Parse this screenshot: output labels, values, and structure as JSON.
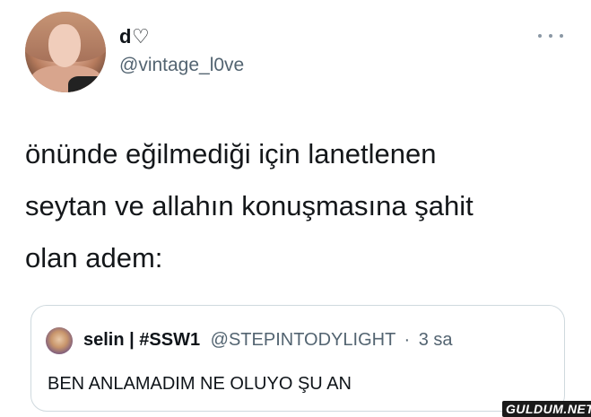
{
  "author": {
    "display_name": "d♡",
    "username": "@vintage_l0ve"
  },
  "tweet": {
    "lines": [
      "önünde eğilmediği için lanetlenen",
      "seytan ve allahın konuşmasına şahit",
      "olan adem:"
    ]
  },
  "quoted_tweet": {
    "name": "selin | #SSW1",
    "handle": "@STEPINTODYLIGHT",
    "separator": "·",
    "time": "3 sa",
    "text": "BEN ANLAMADIM NE OLUYO ŞU AN"
  },
  "watermark": "GULDUM.NET",
  "icons": {
    "more": "more-horizontal-icon"
  },
  "colors": {
    "text": "#0f1419",
    "secondary": "#536471",
    "border": "#cfd9de"
  }
}
